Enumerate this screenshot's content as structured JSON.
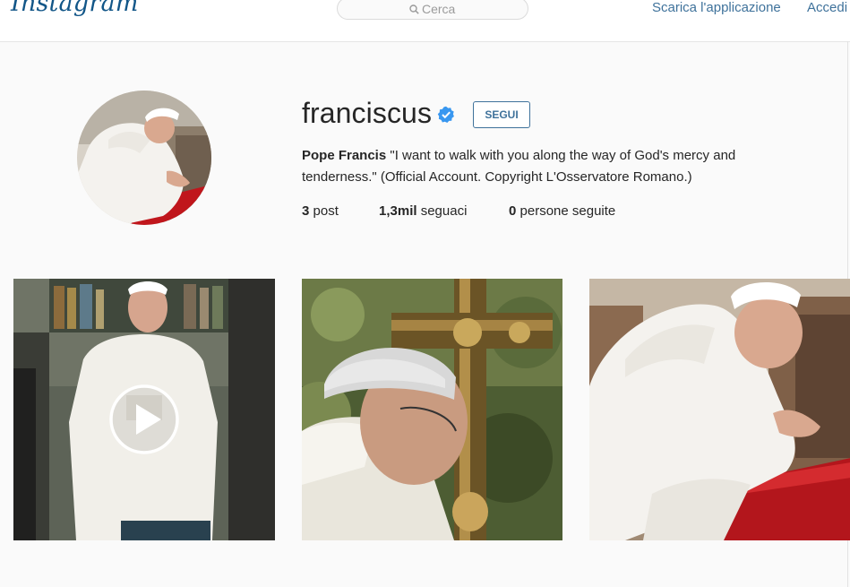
{
  "header": {
    "logo_text": "Instagram",
    "search_placeholder": "Cerca",
    "nav": {
      "download": "Scarica l'applicazione",
      "login": "Accedi"
    }
  },
  "profile": {
    "username": "franciscus",
    "verified": true,
    "follow_label": "SEGUI",
    "full_name": "Pope Francis",
    "bio": " \"I want to walk with you along the way of God's mercy and tenderness.\" (Official Account. Copyright L'Osservatore Romano.)",
    "stats": {
      "posts_count": "3",
      "posts_label": " post",
      "followers_count": "1,3mil",
      "followers_label": " seguaci",
      "following_count": "0",
      "following_label": " persone seguite"
    }
  },
  "posts": [
    {
      "type": "video",
      "icon": "play-icon"
    },
    {
      "type": "photo"
    },
    {
      "type": "photo"
    }
  ],
  "colors": {
    "brand_blue": "#3f729b",
    "logo_blue": "#125688",
    "verified_blue": "#3897f0",
    "background": "#fafafa"
  }
}
